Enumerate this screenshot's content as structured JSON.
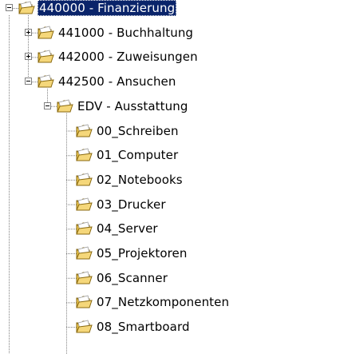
{
  "tree": {
    "nodes": [
      {
        "label": "440000 - Finanzierung",
        "state": "expanded",
        "selected": true,
        "level": 0
      },
      {
        "label": "441000 - Buchhaltung",
        "state": "collapsed",
        "selected": false,
        "level": 1
      },
      {
        "label": "442000 - Zuweisungen",
        "state": "collapsed",
        "selected": false,
        "level": 1
      },
      {
        "label": "442500 - Ansuchen",
        "state": "expanded",
        "selected": false,
        "level": 1
      },
      {
        "label": "EDV - Ausstattung",
        "state": "expanded",
        "selected": false,
        "level": 2
      },
      {
        "label": "00_Schreiben",
        "state": "leaf",
        "selected": false,
        "level": 3
      },
      {
        "label": "01_Computer",
        "state": "leaf",
        "selected": false,
        "level": 3
      },
      {
        "label": "02_Notebooks",
        "state": "leaf",
        "selected": false,
        "level": 3
      },
      {
        "label": "03_Drucker",
        "state": "leaf",
        "selected": false,
        "level": 3
      },
      {
        "label": "04_Server",
        "state": "leaf",
        "selected": false,
        "level": 3
      },
      {
        "label": "05_Projektoren",
        "state": "leaf",
        "selected": false,
        "level": 3
      },
      {
        "label": "06_Scanner",
        "state": "leaf",
        "selected": false,
        "level": 3
      },
      {
        "label": "07_Netzkomponenten",
        "state": "leaf",
        "selected": false,
        "level": 3
      },
      {
        "label": "08_Smartboard",
        "state": "leaf",
        "selected": false,
        "level": 3
      }
    ],
    "icon": "open-folder-icon",
    "colors": {
      "selection": "#0a246a",
      "folder": "#f5d77a",
      "folder_outline": "#8a6a10",
      "tree_lines": "#808080"
    }
  }
}
